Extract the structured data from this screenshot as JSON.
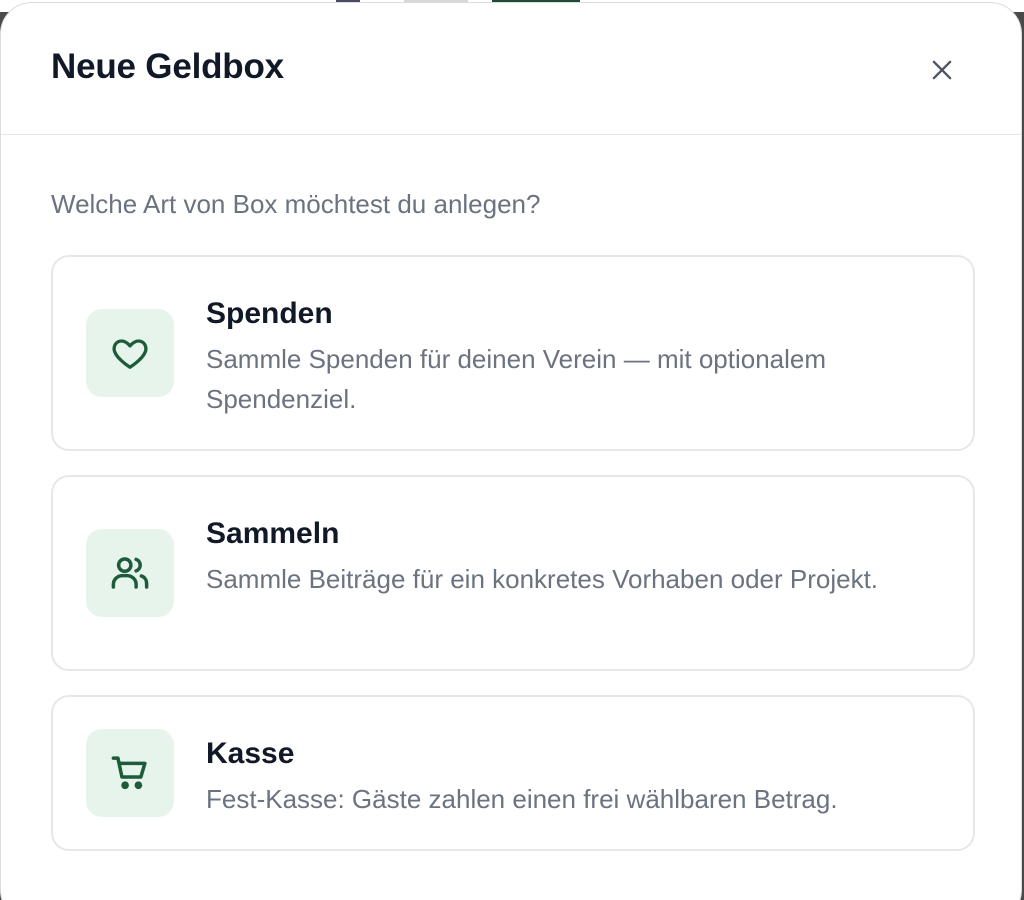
{
  "modal": {
    "title": "Neue Geldbox",
    "prompt": "Welche Art von Box möchtest du anlegen?",
    "close_icon": "close-icon"
  },
  "options": [
    {
      "title": "Spenden",
      "description": "Sammle Spenden für deinen Verein — mit optionalem Spendenziel.",
      "icon": "heart-icon"
    },
    {
      "title": "Sammeln",
      "description": "Sammle Beiträge für ein konkretes Vorhaben oder Projekt.",
      "icon": "users-icon"
    },
    {
      "title": "Kasse",
      "description": "Fest-Kasse: Gäste zahlen einen frei wählbaren Betrag.",
      "icon": "shopping-cart-icon"
    }
  ],
  "colors": {
    "accent": "#1d5c3a",
    "icon_tile_bg": "#e7f4ec",
    "title_text": "#111827",
    "muted_text": "#6b7280",
    "border": "#e5e7eb"
  }
}
